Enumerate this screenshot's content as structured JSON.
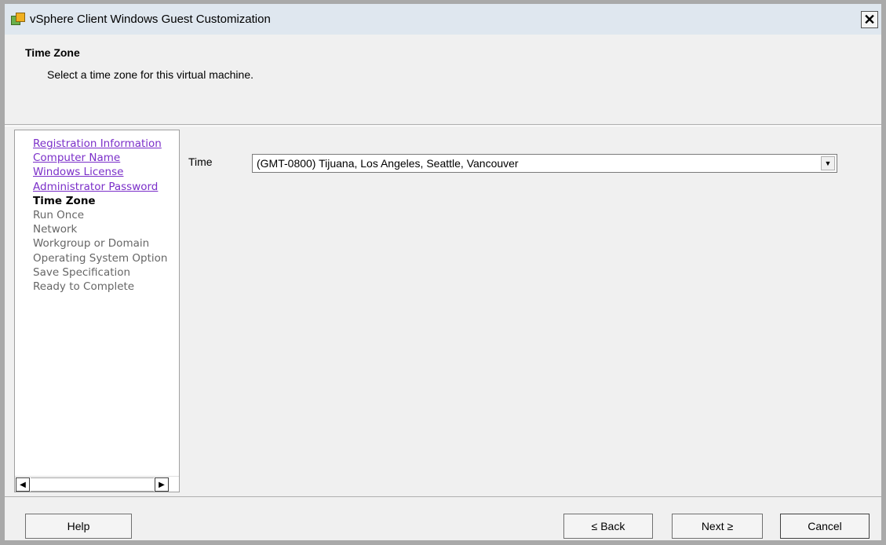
{
  "window": {
    "title": "vSphere Client Windows Guest Customization",
    "close_glyph": "✕"
  },
  "header": {
    "title": "Time Zone",
    "description": "Select a time zone for this virtual machine."
  },
  "nav": {
    "completed": [
      "Registration Information",
      "Computer Name",
      "Windows License",
      "Administrator Password"
    ],
    "current": "Time Zone",
    "pending": [
      "Run Once",
      "Network",
      "Workgroup or Domain",
      "Operating System Option",
      "Save Specification",
      "Ready to Complete"
    ]
  },
  "form": {
    "time_label": "Time",
    "time_zone_value": "(GMT-0800) Tijuana, Los Angeles, Seattle, Vancouver"
  },
  "buttons": {
    "help": "Help",
    "back": "≤ Back",
    "next": "Next ≥",
    "cancel": "Cancel"
  },
  "colors": {
    "link": "#7b2fc9",
    "titlebar": "#dfe7ef"
  }
}
